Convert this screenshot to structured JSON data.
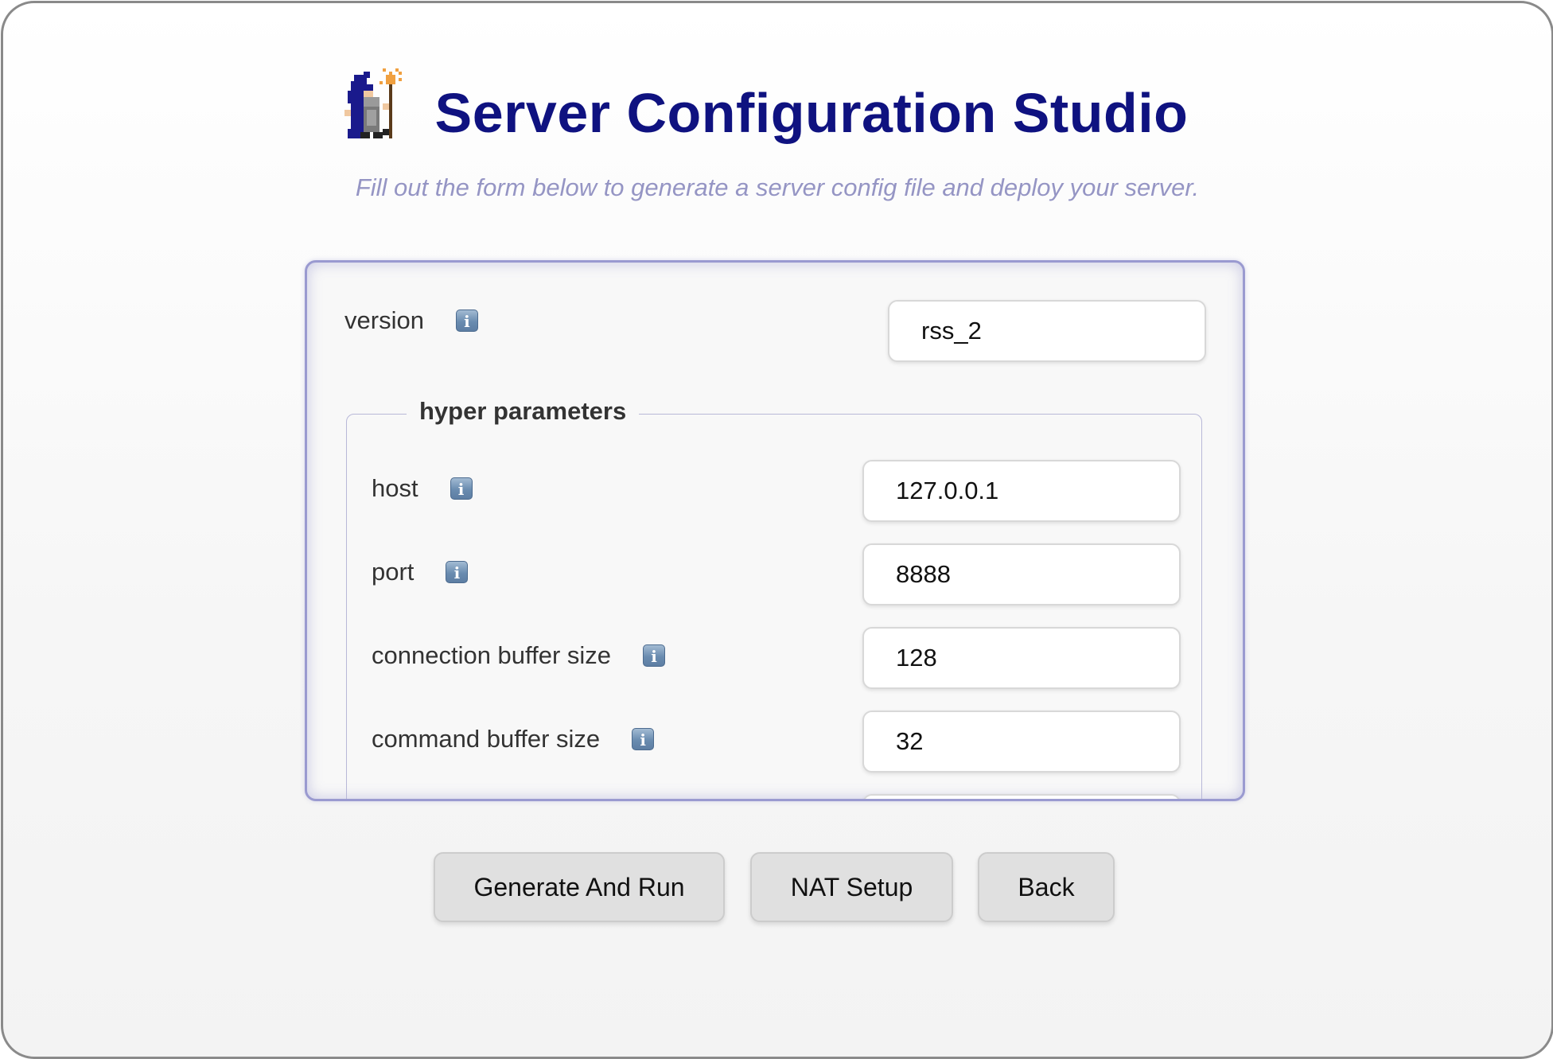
{
  "header": {
    "logo": "wizard-icon",
    "title": "Server Configuration Studio",
    "subtitle": "Fill out the form below to generate a server config file and deploy your server."
  },
  "form": {
    "version": {
      "label": "version",
      "info_icon": "info-icon",
      "value": "rss_2"
    },
    "hyper_parameters": {
      "legend": "hyper parameters",
      "fields": [
        {
          "label": "host",
          "value": "127.0.0.1"
        },
        {
          "label": "port",
          "value": "8888"
        },
        {
          "label": "connection buffer size",
          "value": "128"
        },
        {
          "label": "command buffer size",
          "value": "32"
        }
      ]
    }
  },
  "buttons": {
    "generate": "Generate And Run",
    "nat": "NAT Setup",
    "back": "Back"
  },
  "colors": {
    "title": "#0f1280",
    "subtitle": "#9595c4",
    "panel_border": "#9a9ad0",
    "button_bg": "#e0e0e0"
  }
}
